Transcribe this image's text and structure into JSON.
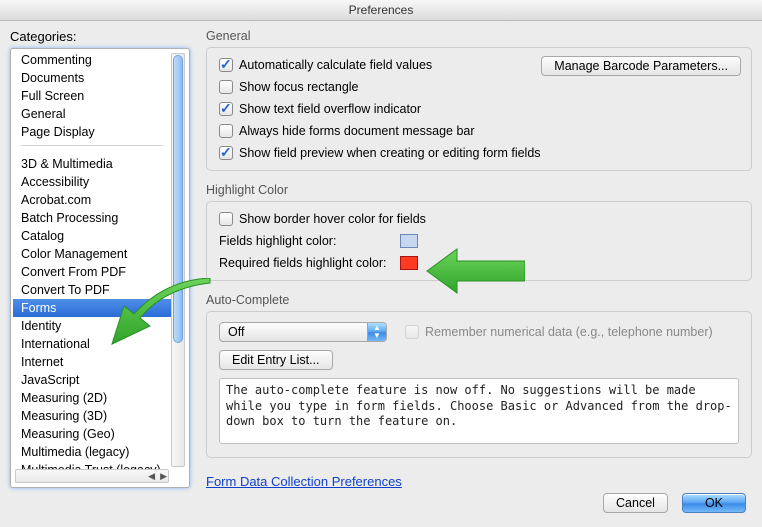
{
  "window": {
    "title": "Preferences"
  },
  "sidebar": {
    "label": "Categories:",
    "group1": [
      "Commenting",
      "Documents",
      "Full Screen",
      "General",
      "Page Display"
    ],
    "group2": [
      "3D & Multimedia",
      "Accessibility",
      "Acrobat.com",
      "Batch Processing",
      "Catalog",
      "Color Management",
      "Convert From PDF",
      "Convert To PDF",
      "Forms",
      "Identity",
      "International",
      "Internet",
      "JavaScript",
      "Measuring (2D)",
      "Measuring (3D)",
      "Measuring (Geo)",
      "Multimedia (legacy)",
      "Multimedia Trust (legacy)"
    ],
    "selected": "Forms"
  },
  "general": {
    "heading": "General",
    "auto_calc": "Automatically calculate field values",
    "focus_rect": "Show focus rectangle",
    "overflow": "Show text field overflow indicator",
    "hide_msg": "Always hide forms document message bar",
    "preview": "Show field preview when creating or editing form fields",
    "barcode_btn": "Manage Barcode Parameters..."
  },
  "highlight": {
    "heading": "Highlight Color",
    "border_hover": "Show border hover color for fields",
    "fields_label": "Fields highlight color:",
    "required_label": "Required fields highlight color:"
  },
  "autocomplete": {
    "heading": "Auto-Complete",
    "select_value": "Off",
    "remember": "Remember numerical data (e.g., telephone number)",
    "edit_btn": "Edit Entry List...",
    "textarea": "The auto-complete feature is now off. No suggestions will be made while you type in form fields. Choose Basic or Advanced from the drop-down box to turn the feature on."
  },
  "link_text": "Form Data Collection Preferences",
  "footer": {
    "cancel": "Cancel",
    "ok": "OK"
  }
}
